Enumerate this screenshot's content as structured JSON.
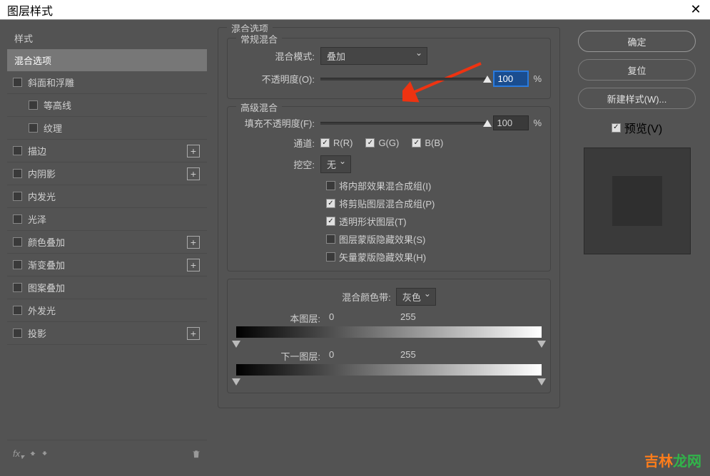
{
  "title": "图层样式",
  "sidebar": {
    "header": "样式",
    "selected": "混合选项",
    "items": [
      {
        "label": "斜面和浮雕",
        "plus": false,
        "indent": false
      },
      {
        "label": "等高线",
        "plus": false,
        "indent": true
      },
      {
        "label": "纹理",
        "plus": false,
        "indent": true
      },
      {
        "label": "描边",
        "plus": true,
        "indent": false
      },
      {
        "label": "内阴影",
        "plus": true,
        "indent": false
      },
      {
        "label": "内发光",
        "plus": false,
        "indent": false
      },
      {
        "label": "光泽",
        "plus": false,
        "indent": false
      },
      {
        "label": "颜色叠加",
        "plus": true,
        "indent": false
      },
      {
        "label": "渐变叠加",
        "plus": true,
        "indent": false
      },
      {
        "label": "图案叠加",
        "plus": false,
        "indent": false
      },
      {
        "label": "外发光",
        "plus": false,
        "indent": false
      },
      {
        "label": "投影",
        "plus": true,
        "indent": false
      }
    ],
    "fx": "fx"
  },
  "blend": {
    "section_title": "混合选项",
    "general_title": "常规混合",
    "mode_label": "混合模式:",
    "mode_value": "叠加",
    "opacity_label": "不透明度(O):",
    "opacity_value": "100",
    "opacity_unit": "%",
    "advanced_title": "高级混合",
    "fill_label": "填充不透明度(F):",
    "fill_value": "100",
    "fill_unit": "%",
    "channels_label": "通道:",
    "ch_r": "R(R)",
    "ch_g": "G(G)",
    "ch_b": "B(B)",
    "knockout_label": "挖空:",
    "knockout_value": "无",
    "opt1": "将内部效果混合成组(I)",
    "opt2": "将剪贴图层混合成组(P)",
    "opt3": "透明形状图层(T)",
    "opt4": "图层蒙版隐藏效果(S)",
    "opt5": "矢量蒙版隐藏效果(H)",
    "blendif_label": "混合颜色带:",
    "blendif_value": "灰色",
    "this_layer": "本图层:",
    "this_lo": "0",
    "this_hi": "255",
    "under_layer": "下一图层:",
    "under_lo": "0",
    "under_hi": "255"
  },
  "right": {
    "ok": "确定",
    "reset": "复位",
    "new_style": "新建样式(W)...",
    "preview": "预览(V)"
  },
  "watermark_a": "吉林",
  "watermark_b": "龙网"
}
